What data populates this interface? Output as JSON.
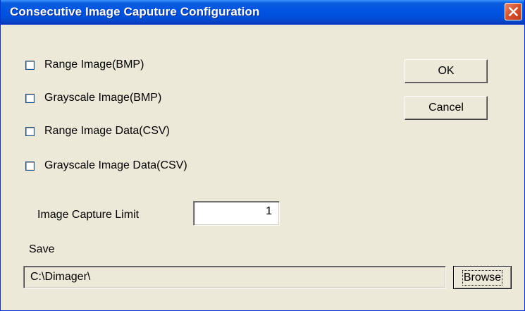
{
  "window": {
    "title": "Consecutive Image Caputure Configuration"
  },
  "checkboxes": [
    {
      "label": "Range Image(BMP)",
      "checked": false
    },
    {
      "label": "Grayscale Image(BMP)",
      "checked": false
    },
    {
      "label": "Range Image Data(CSV)",
      "checked": false
    },
    {
      "label": "Grayscale Image Data(CSV)",
      "checked": false
    }
  ],
  "buttons": {
    "ok_label": "OK",
    "cancel_label": "Cancel",
    "browse_label": "Browse"
  },
  "capture_limit": {
    "label": "Image Capture Limit",
    "value": "1"
  },
  "save": {
    "label": "Save",
    "path": "C:\\Dimager\\"
  },
  "icons": {
    "close": "close-icon",
    "checkbox": "checkbox-icon"
  },
  "colors": {
    "title_bar": "#0053e1",
    "dialog_background": "#ece9d8",
    "close_button": "#d5552f"
  }
}
